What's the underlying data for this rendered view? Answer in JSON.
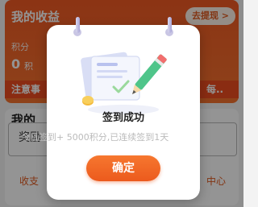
{
  "background": {
    "earnings_title": "我的收益",
    "withdraw_button": "去提现 >",
    "points_label": "积分",
    "points_value": "0",
    "points_unit": "积",
    "notice_text": "注意事",
    "notice_tail": "每..",
    "section2_title": "我的",
    "lottery_label": "奖励",
    "bottom_left": "收支",
    "bottom_right": "中心"
  },
  "modal": {
    "title": "签到成功",
    "detail": "今日签到+ 5000积分,已连续签到1天",
    "confirm_button": "确定"
  },
  "colors": {
    "accent": "#f0642a",
    "overlay": "rgba(0,0,0,0.42)"
  },
  "icons": [
    "calendar-ring-icon",
    "pencil-icon",
    "coin-icon",
    "document-icon"
  ]
}
